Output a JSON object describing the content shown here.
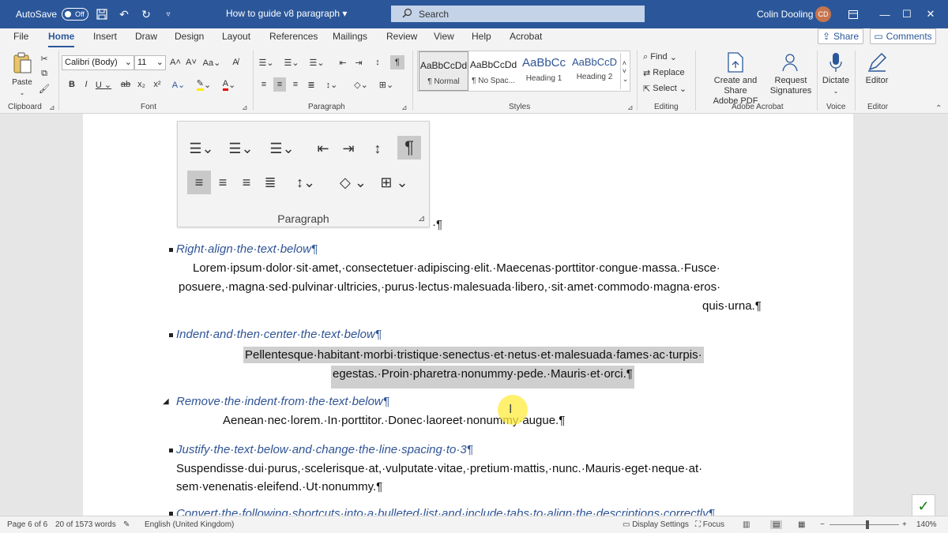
{
  "titlebar": {
    "autosave_label": "AutoSave",
    "autosave_state": "Off",
    "doc_title": "How to guide v8 paragraph",
    "search_placeholder": "Search",
    "user_name": "Colin Dooling",
    "user_initials": "CD"
  },
  "tabs": [
    "File",
    "Home",
    "Insert",
    "Draw",
    "Design",
    "Layout",
    "References",
    "Mailings",
    "Review",
    "View",
    "Help",
    "Acrobat"
  ],
  "active_tab": "Home",
  "share_label": "Share",
  "comments_label": "Comments",
  "ribbon": {
    "clipboard": {
      "label": "Clipboard",
      "paste": "Paste"
    },
    "font": {
      "label": "Font",
      "name": "Calibri (Body)",
      "size": "11"
    },
    "paragraph": {
      "label": "Paragraph"
    },
    "styles": {
      "label": "Styles",
      "items": [
        {
          "sample": "AaBbCcDd",
          "name": "¶ Normal"
        },
        {
          "sample": "AaBbCcDd",
          "name": "¶ No Spac..."
        },
        {
          "sample": "AaBbCc",
          "name": "Heading 1"
        },
        {
          "sample": "AaBbCcD",
          "name": "Heading 2"
        }
      ]
    },
    "editing": {
      "label": "Editing",
      "find": "Find",
      "replace": "Replace",
      "select": "Select"
    },
    "acrobat": {
      "label": "Adobe Acrobat",
      "create": "Create and Share",
      "create2": "Adobe PDF",
      "request": "Request",
      "request2": "Signatures"
    },
    "voice": {
      "label": "Voice",
      "dictate": "Dictate"
    },
    "editor": {
      "label": "Editor",
      "editor": "Editor"
    }
  },
  "document": {
    "paragraph_group_label": "Paragraph",
    "items": [
      {
        "heading": "Right·align·the·text·below¶",
        "lines": [
          "Lorem·ipsum·dolor·sit·amet,·consectetuer·adipiscing·elit.·Maecenas·porttitor·congue·massa.·Fusce·",
          "posuere,·magna·sed·pulvinar·ultricies,·purus·lectus·malesuada·libero,·sit·amet·commodo·magna·eros·",
          "quis·urna.¶"
        ]
      },
      {
        "heading": "Indent·and·then·center·the·text·below¶",
        "lines": [
          "Pellentesque·habitant·morbi·tristique·senectus·et·netus·et·malesuada·fames·ac·turpis·",
          "egestas.·Proin·pharetra·nonummy·pede.·Mauris·et·orci.¶"
        ]
      },
      {
        "heading": "Remove·the·indent·from·the·text·below¶",
        "lines": [
          "Aenean·nec·lorem.·In·porttitor.·Donec·laoreet·nonummy·augue.¶"
        ]
      },
      {
        "heading": "Justify·the·text·below·and·change·the·line·spacing·to·3¶",
        "lines": [
          "Suspendisse·dui·purus,·scelerisque·at,·vulputate·vitae,·pretium·mattis,·nunc.·Mauris·eget·neque·at·",
          "sem·venenatis·eleifend.·Ut·nonummy.¶"
        ]
      },
      {
        "heading": "Convert·the·following·shortcuts·into·a·bulleted·list·and·include·tabs·to·align·the·descriptions·correctly¶"
      }
    ]
  },
  "statusbar": {
    "page": "Page 6 of 6",
    "words": "20 of 1573 words",
    "language": "English (United Kingdom)",
    "display_settings": "Display Settings",
    "focus": "Focus",
    "zoom": "140%"
  }
}
